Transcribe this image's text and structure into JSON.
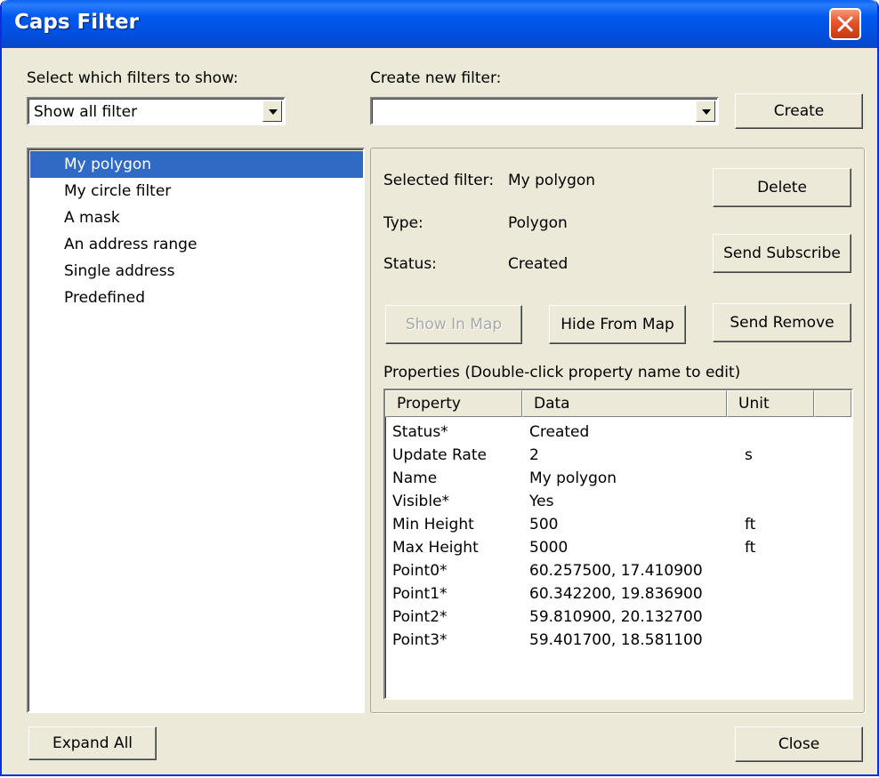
{
  "window": {
    "title": "Caps Filter"
  },
  "show_filters": {
    "label": "Select which filters to show:",
    "value": "Show all filter"
  },
  "create_filter": {
    "label": "Create new filter:",
    "value": "",
    "button": "Create"
  },
  "filter_list": {
    "items": [
      "My polygon",
      "My circle filter",
      "A mask",
      "An address range",
      "Single address",
      "Predefined"
    ],
    "selected": "My polygon"
  },
  "details": {
    "selected_label": "Selected filter:",
    "selected_value": "My polygon",
    "type_label": "Type:",
    "type_value": "Polygon",
    "status_label": "Status:",
    "status_value": "Created"
  },
  "buttons": {
    "delete": "Delete",
    "send_subscribe": "Send Subscribe",
    "show_in_map": "Show In Map",
    "hide_from_map": "Hide From Map",
    "send_remove": "Send Remove",
    "expand_all": "Expand All",
    "close": "Close"
  },
  "properties": {
    "label": "Properties (Double-click property name to edit)",
    "columns": [
      "Property",
      "Data",
      "Unit"
    ],
    "rows": [
      [
        "Status*",
        "Created",
        ""
      ],
      [
        "Update Rate",
        "2",
        "s"
      ],
      [
        "Name",
        "My polygon",
        ""
      ],
      [
        "Visible*",
        "Yes",
        ""
      ],
      [
        "Min Height",
        "500",
        "ft"
      ],
      [
        "Max Height",
        "5000",
        "ft"
      ],
      [
        "Point0*",
        "60.257500, 17.410900",
        ""
      ],
      [
        "Point1*",
        "60.342200, 19.836900",
        ""
      ],
      [
        "Point2*",
        "59.810900, 20.132700",
        ""
      ],
      [
        "Point3*",
        "59.401700, 18.581100",
        ""
      ]
    ]
  }
}
